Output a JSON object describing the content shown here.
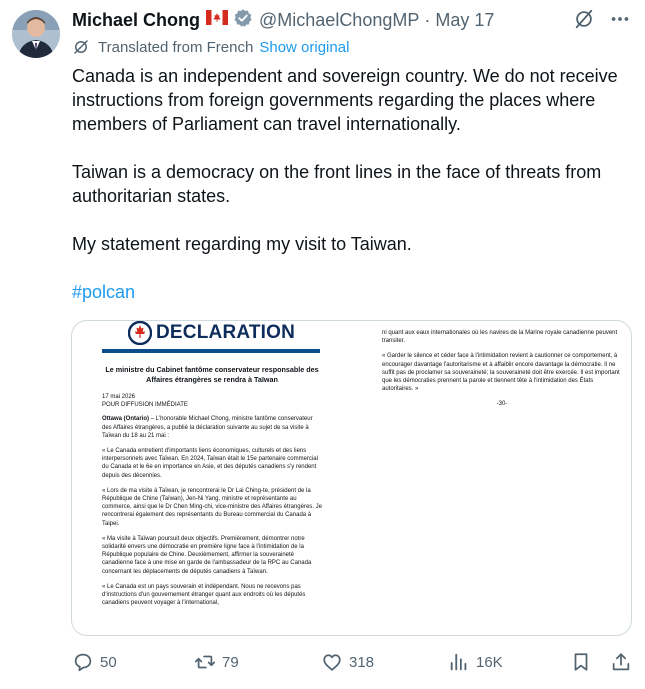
{
  "author": {
    "name": "Michael Chong",
    "handle": "@MichaelChongMP",
    "date": "May 17"
  },
  "translation": {
    "label": "Translated from French",
    "show_original": "Show original"
  },
  "tweet": {
    "paragraph1": "Canada is an independent and sovereign country. We do not receive instructions from foreign governments regarding the places where members of Parliament can travel internationally.",
    "paragraph2": "Taiwan is a democracy on the front lines in the face of threats from authoritarian states.",
    "paragraph3": "My statement regarding my visit to Taiwan.",
    "hashtag": "#polcan"
  },
  "document": {
    "heading": "DECLARATION",
    "title": "Le ministre du Cabinet fantôme conservateur responsable des Affaires étrangères se rendra à Taïwan",
    "date": "17 mai 2026",
    "release": "POUR DIFFUSION IMMÉDIATE",
    "intro_place": "Ottawa (Ontario)",
    "intro": " – L'honorable Michael Chong, ministre fantôme conservateur des Affaires étrangères, a publié la déclaration suivante au sujet de sa visite à Taïwan du 18 au 21 mai :",
    "p1": "« Le Canada entretient d'importants liens économiques, culturels et des liens interpersonnels avec Taïwan. En 2024, Taïwan était le 15e partenaire commercial du Canada et le 6e en importance en Asie, et des députés canadiens s'y rendent depuis des décennies.",
    "p2": "« Lors de ma visite à Taïwan, je rencontrerai le Dr Lai Ching-te, président de la République de Chine (Taïwan), Jen-Ni Yang, ministre et représentante au commerce, ainsi que le Dr Chen Ming-chi, vice-ministre des Affaires étrangères. Je rencontrerai également des représentants du Bureau commercial du Canada à Taipei.",
    "p3": "« Ma visite à Taïwan poursuit deux objectifs. Premièrement, démontrer notre solidarité envers une démocratie en première ligne face à l'intimidation de la République populaire de Chine. Deuxièmement, affirmer la souveraineté canadienne face à une mise en garde de l'ambassadeur de la RPC au Canada concernant les déplacements de députés canadiens à Taïwan.",
    "p4": "« Le Canada est un pays souverain et indépendant. Nous ne recevons pas d'instructions d'un gouvernement étranger quant aux endroits où les députés canadiens peuvent voyager à l'international,",
    "c2p1": "ni quant aux eaux internationales où les navires de la Marine royale canadienne peuvent transiter.",
    "c2p2": "« Garder le silence et céder face à l'intimidation revient à cautionner ce comportement, à encourager davantage l'autoritarisme et à affaiblir encore davantage la démocratie. Il ne suffit pas de proclamer sa souveraineté; la souveraineté doit être exercée. Il est important que les démocraties prennent la parole et tiennent tête à l'intimidation des États autoritaires. »",
    "end": "-30-"
  },
  "actions": {
    "replies": "50",
    "reposts": "79",
    "likes": "318",
    "views": "16K"
  },
  "colors": {
    "accent": "#1d9bf0",
    "muted": "#536471",
    "text": "#0f1419",
    "border": "#cfd9de",
    "flag_red": "#d52b1e",
    "doc_blue": "#0e2d5c"
  },
  "icons": [
    "verified-badge-icon",
    "grok-icon",
    "more-icon",
    "translate-icon",
    "reply-icon",
    "repost-icon",
    "like-icon",
    "views-icon",
    "bookmark-icon",
    "share-icon"
  ]
}
